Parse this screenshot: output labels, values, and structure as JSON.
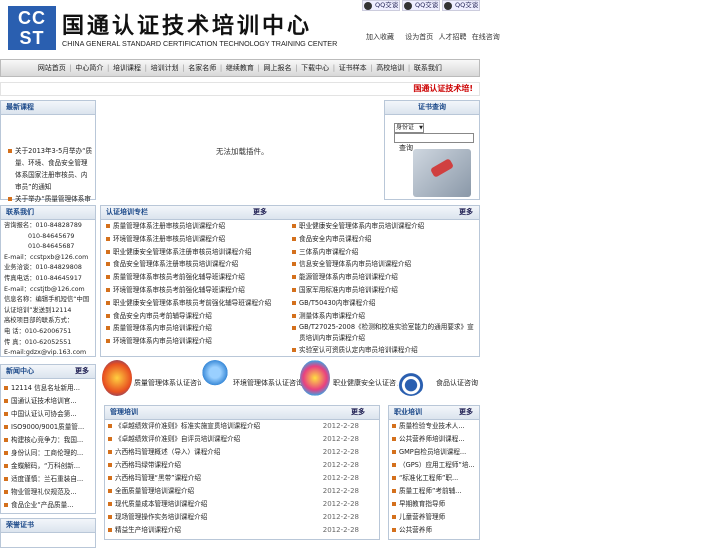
{
  "logo": {
    "abbr_top": "CC",
    "abbr_bottom": "ST",
    "cn": "国通认证技术培训中心",
    "en": "CHINA GENERAL STANDARD CERTIFICATION TECHNOLOGY TRAINING CENTER"
  },
  "qq": [
    "QQ交谈",
    "QQ交谈",
    "QQ交谈"
  ],
  "toplinks": [
    "加入收藏",
    "设为首页",
    "人才招聘",
    "在线咨询"
  ],
  "nav": [
    "网站首页",
    "中心简介",
    "培训课程",
    "培训计划",
    "名家名师",
    "继续教育",
    "网上报名",
    "下载中心",
    "证书样本",
    "高校培训",
    "联系我们"
  ],
  "marquee": "国通认证技术培!",
  "latest": {
    "title": "最新课程",
    "items": [
      "关于2013年3-5月举办“质量、环境、食品安全管理体系国家注册审核员、内审员”的通知",
      "关于举办“质量管理体系审核员考前强化辅导班”的通知"
    ]
  },
  "plugin_msg": "无法加载插件。",
  "cert": {
    "title": "证书查询",
    "select": "身份证",
    "button": "查询"
  },
  "contact": {
    "title": "联系我们",
    "lines": [
      "咨询报名：010-84828789",
      "010-84645679",
      "010-84645687",
      "E-mail：ccstpxb@126.com",
      "业务洽谈：010-84829808",
      "传真电话：010-84645917",
      "E-mail：ccstjtb@126.com",
      "信息名称：编辑手机短信“中国认证培训”发送到12114",
      "高校项目部的联系方式：",
      "电 话：010-62006751",
      "传 真：010-62052551",
      "E-mail:gdzx@vip.163.com"
    ]
  },
  "auth": {
    "title": "认证培训专栏",
    "more": "更多",
    "col1": [
      "质量管理体系注册审核员培训课程介绍",
      "环境管理体系注册审核员培训课程介绍",
      "职业健康安全管理体系注册审核员培训课程介绍",
      "食品安全管理体系注册审核员培训课程介绍",
      "质量管理体系审核员考前强化辅导班课程介绍",
      "环境管理体系审核员考前强化辅导班课程介绍",
      "职业健康安全管理体系审核员考前强化辅导班课程介绍",
      "食品安全内审员考前辅导课程介绍",
      "质量管理体系内审员培训课程介绍",
      "环境管理体系内审员培训课程介绍"
    ],
    "col2": [
      "职业健康安全管理体系内审员培训课程介绍",
      "食品安全内审员课程介绍",
      "三体系内审课程介绍",
      "信息安全管理体系内审员培训课程介绍",
      "能源管理体系内审员培训课程介绍",
      "国家军用标准内审员培训课程介绍",
      "GB/T50430内审课程介绍",
      "测量体系内审课程介绍",
      "GB/T27025-2008《检测和校准实验室能力的通用要求》宣贯培训内审员课程介绍",
      "实验室认可资质认定内审员培训课程介绍"
    ]
  },
  "news": {
    "title": "新闻中心",
    "more": "更多",
    "items": [
      "12114 信息名址新用...",
      "国通认证技术培训官...",
      "中国认证认可协会第...",
      "ISO9000/9001质量管...",
      "构建核心竞争力：我国...",
      "身份认同：工商伦理的...",
      "金蝶解码，“万科创新...",
      "适度谨慎：兰石重装自...",
      "物业管理礼仪规范及...",
      "食品企业“产品质量..."
    ]
  },
  "center": [
    {
      "label": "质量管理体系认证咨询",
      "color": "#e8a020"
    },
    {
      "label": "环境管理体系认证咨询",
      "color": "#3a8ad8"
    },
    {
      "label": "职业健康安全认证咨询",
      "color": "#d83a8a"
    },
    {
      "label": "食品认证咨询",
      "color": "#2a5fb0"
    }
  ],
  "mgmt": {
    "title": "管理培训",
    "more": "更多",
    "items": [
      {
        "t": "《卓越绩效评价准则》标准实施宣贯培训课程介绍",
        "d": "2012-2-28"
      },
      {
        "t": "《卓越绩效评价准则》自评员培训课程介绍",
        "d": "2012-2-28"
      },
      {
        "t": "六西格玛管理概述（导入）课程介绍",
        "d": "2012-2-28"
      },
      {
        "t": "六西格玛绿带课程介绍",
        "d": "2012-2-28"
      },
      {
        "t": "六西格玛管理“黑带”课程介绍",
        "d": "2012-2-28"
      },
      {
        "t": "全面质量管理培训课程介绍",
        "d": "2012-2-28"
      },
      {
        "t": "现代质量成本管理培训课程介绍",
        "d": "2012-2-28"
      },
      {
        "t": "现场管理操作实务培训课程介绍",
        "d": "2012-2-28"
      },
      {
        "t": "精益生产培训课程介绍",
        "d": "2012-2-28"
      }
    ]
  },
  "job": {
    "title": "职业培训",
    "more": "更多",
    "items": [
      "质量检验专业技术人...",
      "公共营养师培训课程...",
      "GMP自检员培训课程...",
      "（GPS）应用工程师”培...",
      "“标准化工程师”职...",
      "质量工程师”考前辅...",
      "早期教育指导师",
      "儿童营养管理师",
      "公共营养师"
    ]
  },
  "honor": {
    "title": "荣誉证书"
  }
}
